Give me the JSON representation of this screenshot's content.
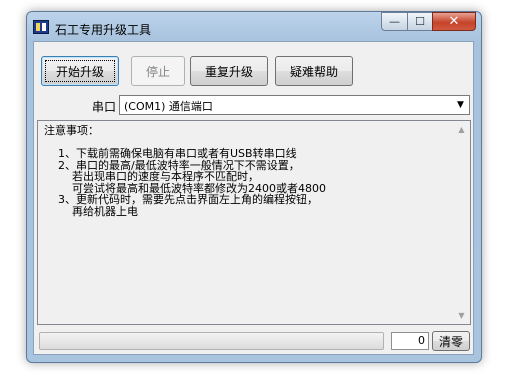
{
  "window": {
    "title": "石工专用升级工具"
  },
  "controls": {
    "minimize": "—",
    "maximize": "☐",
    "close": "✕"
  },
  "toolbar": {
    "start_label": "开始升级",
    "stop_label": "停止",
    "repeat_label": "重复升级",
    "help_label": "疑难帮助"
  },
  "port": {
    "label": "串口",
    "selected": "(COM1) 通信端口"
  },
  "notes": {
    "text": "注意事项：\n\n    1、下载前需确保电脑有串口或者有USB转串口线\n    2、串口的最高/最低波特率一般情况下不需设置，\n        若出现串口的速度与本程序不匹配时，\n        可尝试将最高和最低波特率都修改为2400或者4800\n    3、更新代码时，需要先点击界面左上角的编程按钮，\n        再给机器上电"
  },
  "status": {
    "progress": 0,
    "count": "0",
    "clear_label": "清零"
  },
  "colors": {
    "progress_fill": "#37b24d",
    "title_bar": "#a9c4df",
    "close_button": "#c6432a"
  },
  "icons": {
    "app": "app-icon",
    "dropdown": "chevron-down-icon"
  }
}
